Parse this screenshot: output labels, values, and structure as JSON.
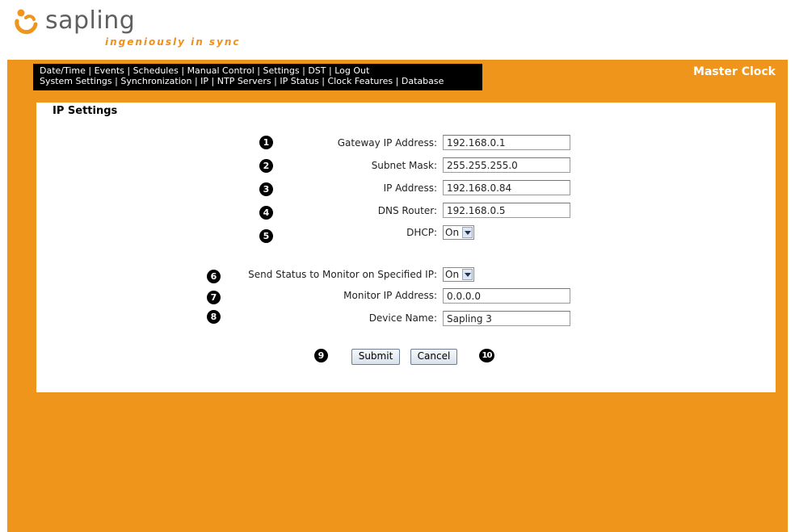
{
  "logo": {
    "word": "sapling",
    "tagline": "ingeniously in sync"
  },
  "nav": {
    "row1": [
      "Date/Time",
      "Events",
      "Schedules",
      "Manual Control",
      "Settings",
      "DST",
      "Log Out"
    ],
    "row2": [
      "System Settings",
      "Synchronization",
      "IP",
      "NTP Servers",
      "IP Status",
      "Clock Features",
      "Database"
    ],
    "separator": " | "
  },
  "brand": "Master Clock",
  "section_title": "IP Settings",
  "form": {
    "gateway": {
      "num": "1",
      "label": "Gateway IP Address:",
      "value": "192.168.0.1"
    },
    "subnet": {
      "num": "2",
      "label": "Subnet Mask:",
      "value": "255.255.255.0"
    },
    "ip": {
      "num": "3",
      "label": "IP Address:",
      "value": "192.168.0.84"
    },
    "dns": {
      "num": "4",
      "label": "DNS Router:",
      "value": "192.168.0.5"
    },
    "dhcp": {
      "num": "5",
      "label": "DHCP:",
      "value": "On"
    },
    "send_status": {
      "num": "6",
      "label": "Send Status to Monitor on Specified IP:",
      "value": "On"
    },
    "monitor_ip": {
      "num": "7",
      "label": "Monitor IP Address:",
      "value": "0.0.0.0"
    },
    "device_name": {
      "num": "8",
      "label": "Device Name:",
      "value": "Sapling 3"
    }
  },
  "buttons": {
    "submit": {
      "num": "9",
      "label": "Submit"
    },
    "cancel": {
      "num": "10",
      "label": "Cancel"
    }
  },
  "colors": {
    "accent": "#f0951c",
    "nav_bg": "#000000",
    "logo_text": "#5f5f5f"
  }
}
